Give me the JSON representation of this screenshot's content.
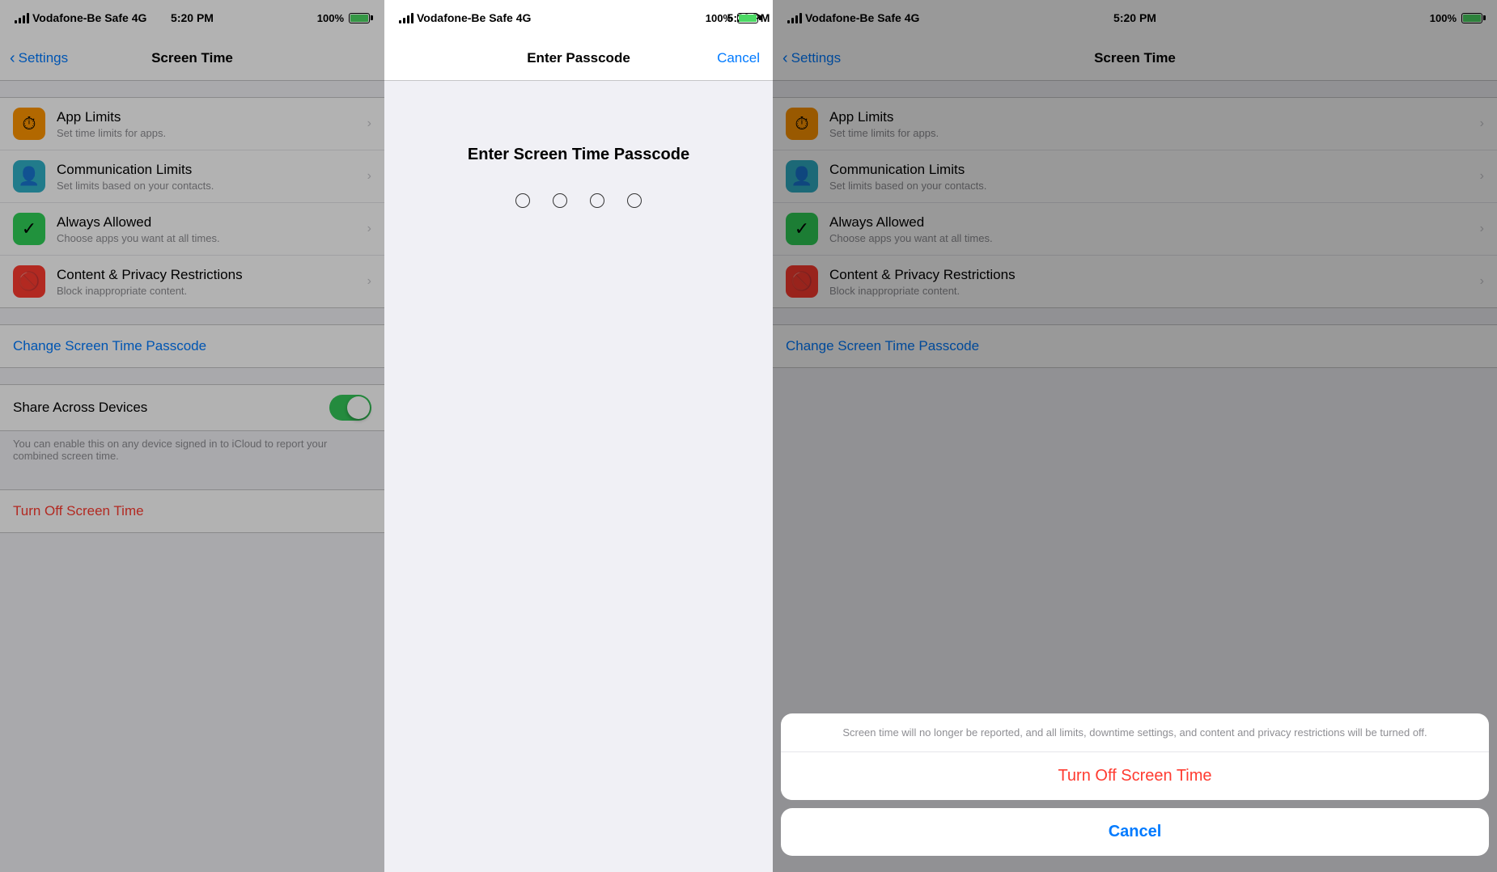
{
  "panel1": {
    "status": {
      "carrier": "Vodafone-Be Safe",
      "network": "4G",
      "time": "5:20 PM",
      "battery": "100%"
    },
    "nav": {
      "back_label": "Settings",
      "title": "Screen Time"
    },
    "rows": [
      {
        "icon": "⏱",
        "icon_color": "orange",
        "title": "App Limits",
        "subtitle": "Set time limits for apps."
      },
      {
        "icon": "👤",
        "icon_color": "green",
        "title": "Communication Limits",
        "subtitle": "Set limits based on your contacts."
      },
      {
        "icon": "✓",
        "icon_color": "green2",
        "title": "Always Allowed",
        "subtitle": "Choose apps you want at all times."
      },
      {
        "icon": "🚫",
        "icon_color": "red",
        "title": "Content & Privacy Restrictions",
        "subtitle": "Block inappropriate content."
      }
    ],
    "change_passcode_label": "Change Screen Time Passcode",
    "share_label": "Share Across Devices",
    "share_desc": "You can enable this on any device signed in to iCloud to report your combined screen time.",
    "turn_off_label": "Turn Off Screen Time"
  },
  "panel2": {
    "status": {
      "carrier": "Vodafone-Be Safe",
      "network": "4G",
      "time": "5:20 PM",
      "battery": "100%"
    },
    "nav": {
      "title": "Enter Passcode",
      "cancel_label": "Cancel"
    },
    "prompt": "Enter Screen Time Passcode",
    "dots": 4
  },
  "panel3": {
    "status": {
      "carrier": "Vodafone-Be Safe",
      "network": "4G",
      "time": "5:20 PM",
      "battery": "100%"
    },
    "nav": {
      "back_label": "Settings",
      "title": "Screen Time"
    },
    "rows": [
      {
        "icon": "⏱",
        "icon_color": "orange",
        "title": "App Limits",
        "subtitle": "Set time limits for apps."
      },
      {
        "icon": "👤",
        "icon_color": "green",
        "title": "Communication Limits",
        "subtitle": "Set limits based on your contacts."
      },
      {
        "icon": "✓",
        "icon_color": "green2",
        "title": "Always Allowed",
        "subtitle": "Choose apps you want at all times."
      },
      {
        "icon": "🚫",
        "icon_color": "red",
        "title": "Content & Privacy Restrictions",
        "subtitle": "Block inappropriate content."
      }
    ],
    "change_passcode_label": "Change Screen Time Passcode",
    "action_sheet": {
      "desc": "Screen time will no longer be reported, and all limits, downtime settings, and content and privacy restrictions will be turned off.",
      "turn_off_label": "Turn Off Screen Time",
      "cancel_label": "Cancel"
    }
  }
}
